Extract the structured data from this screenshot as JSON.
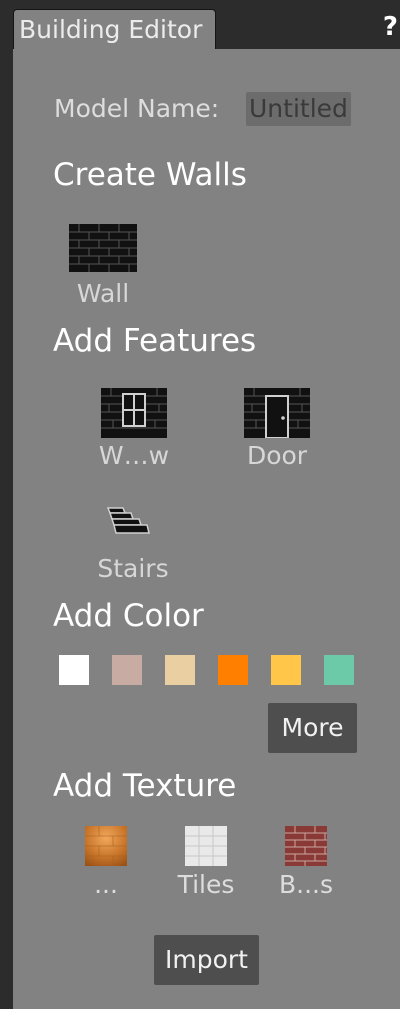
{
  "tab": {
    "title": "Building Editor"
  },
  "help": {
    "label": "?"
  },
  "model": {
    "label": "Model Name:",
    "value": "Untitled"
  },
  "sections": {
    "walls": "Create Walls",
    "features": "Add Features",
    "color": "Add Color",
    "texture": "Add Texture"
  },
  "walls": {
    "wall_label": "Wall"
  },
  "features": {
    "window_label": "W…w",
    "door_label": "Door",
    "stairs_label": "Stairs"
  },
  "colors": {
    "swatches": [
      "#ffffff",
      "#c8aba2",
      "#eacfa2",
      "#ff7f00",
      "#ffc64a",
      "#6ccaa8"
    ],
    "more_label": "More"
  },
  "textures": {
    "wood_label": "...",
    "tiles_label": "Tiles",
    "bricks_label": "B...s"
  },
  "import_label": "Import",
  "icons": [
    "wall-icon",
    "window-icon",
    "door-icon",
    "stairs-icon"
  ]
}
